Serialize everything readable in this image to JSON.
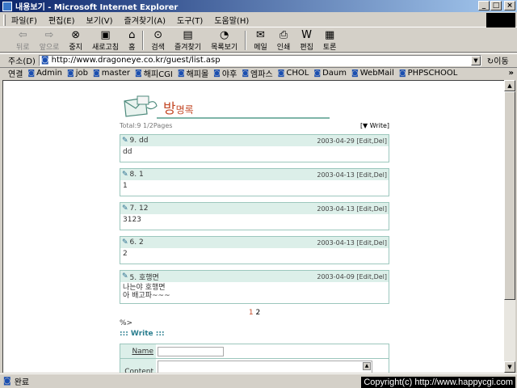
{
  "window": {
    "title": "내용보기 - Microsoft Internet Explorer",
    "minimize": "_",
    "maximize": "□",
    "close": "×"
  },
  "menu": [
    "파일(F)",
    "편집(E)",
    "보기(V)",
    "즐겨찾기(A)",
    "도구(T)",
    "도움말(H)"
  ],
  "toolbar": {
    "back": "뒤로",
    "forward": "앞으로",
    "stop": "중지",
    "refresh": "새로고침",
    "home": "홈",
    "search": "검색",
    "favorites": "즐겨찾기",
    "history": "목록보기",
    "mail": "메일",
    "print": "인쇄",
    "edit": "편집",
    "discuss": "토론"
  },
  "address": {
    "label": "주소(D)",
    "url": "http://www.dragoneye.co.kr/guest/list.asp",
    "go": "이동"
  },
  "links": {
    "label": "연결",
    "items": [
      "Admin",
      "job",
      "master",
      "해피CGI",
      "해피몰",
      "야후",
      "엠파스",
      "CHOL",
      "Daum",
      "WebMail",
      "PHPSCHOOL"
    ],
    "more": "»"
  },
  "guestbook": {
    "title_big": "방",
    "title_small": "명록",
    "total": "Total:9   1/2Pages",
    "write_link": "[▼ Write]",
    "entries": [
      {
        "header": "9.  dd",
        "date": "2003-04-29 [Edit,Del]",
        "body": "dd"
      },
      {
        "header": "8.  1",
        "date": "2003-04-13 [Edit,Del]",
        "body": "1"
      },
      {
        "header": "7.  12",
        "date": "2003-04-13 [Edit,Del]",
        "body": "3123"
      },
      {
        "header": "6.  2",
        "date": "2003-04-13 [Edit,Del]",
        "body": "2"
      },
      {
        "header": "5.  호행면",
        "date": "2003-04-09 [Edit,Del]",
        "body_line1": "나는야 호행면",
        "body_line2": "아 배고파~~~"
      }
    ],
    "pager": {
      "current": "1",
      "next": "2"
    },
    "stray": "%>",
    "write_title": "::: Write :::",
    "form": {
      "name_label": "Name",
      "content_label": "Content"
    }
  },
  "status": {
    "text": "완료",
    "copyright": "Copyright(c) http://www.happycgi.com"
  }
}
